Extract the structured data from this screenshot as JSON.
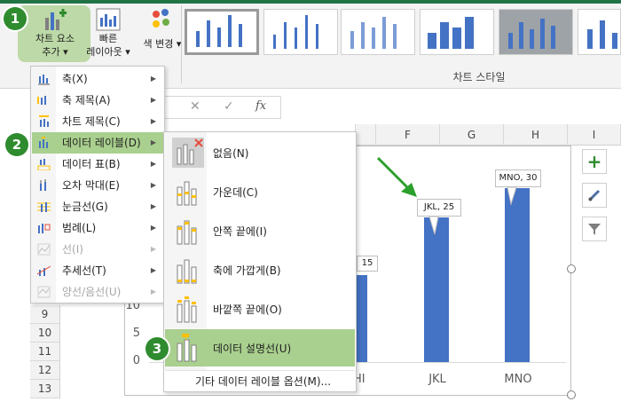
{
  "ribbon": {
    "add_element_label_1": "차트 요소",
    "add_element_label_2": "추가",
    "quick_layout_label_1": "빠른",
    "quick_layout_label_2": "레이아웃",
    "change_colors_label": "색 변경",
    "group_label": "차트 스타일"
  },
  "formula_bar": {
    "fx": "fx",
    "cancel": "✕",
    "enter": "✓"
  },
  "columns": [
    "F",
    "G",
    "H",
    "I"
  ],
  "rows": [
    "9",
    "10",
    "11",
    "12",
    "13"
  ],
  "element_menu": {
    "items": [
      {
        "label": "축(X)",
        "disabled": false
      },
      {
        "label": "축 제목(A)",
        "disabled": false
      },
      {
        "label": "차트 제목(C)",
        "disabled": false
      },
      {
        "label": "데이터 레이블(D)",
        "disabled": false
      },
      {
        "label": "데이터 표(B)",
        "disabled": false
      },
      {
        "label": "오차 막대(E)",
        "disabled": false
      },
      {
        "label": "눈금선(G)",
        "disabled": false
      },
      {
        "label": "범례(L)",
        "disabled": false
      },
      {
        "label": "선(I)",
        "disabled": true
      },
      {
        "label": "추세선(T)",
        "disabled": false
      },
      {
        "label": "양선/음선(U)",
        "disabled": true
      }
    ]
  },
  "label_submenu": {
    "items": [
      {
        "label": "없음(N)"
      },
      {
        "label": "가운데(C)"
      },
      {
        "label": "안쪽 끝에(I)"
      },
      {
        "label": "축에 가깝게(B)"
      },
      {
        "label": "바깥쪽 끝에(O)"
      },
      {
        "label": "데이터 설명선(U)"
      }
    ],
    "more_options": "기타 데이터 레이블 옵션(M)..."
  },
  "steps": [
    "1",
    "2",
    "3"
  ],
  "chart": {
    "y_ticks": [
      "10",
      "5",
      "0"
    ],
    "categories": [
      "HI",
      "JKL",
      "MNO"
    ],
    "callouts": [
      "15",
      "JKL, 25",
      "MNO, 30"
    ]
  },
  "chart_data": {
    "type": "bar",
    "categories": [
      "HI",
      "JKL",
      "MNO"
    ],
    "values": [
      15,
      25,
      30
    ],
    "data_labels": [
      "15",
      "JKL, 25",
      "MNO, 30"
    ],
    "y_tick_labels": [
      "0",
      "5",
      "10"
    ],
    "bar_color": "#4472c4"
  },
  "colors": {
    "accent_green": "#2e8b2e",
    "highlight": "#a9d08e",
    "bar": "#4472c4",
    "arrow": "#2ca02c"
  }
}
